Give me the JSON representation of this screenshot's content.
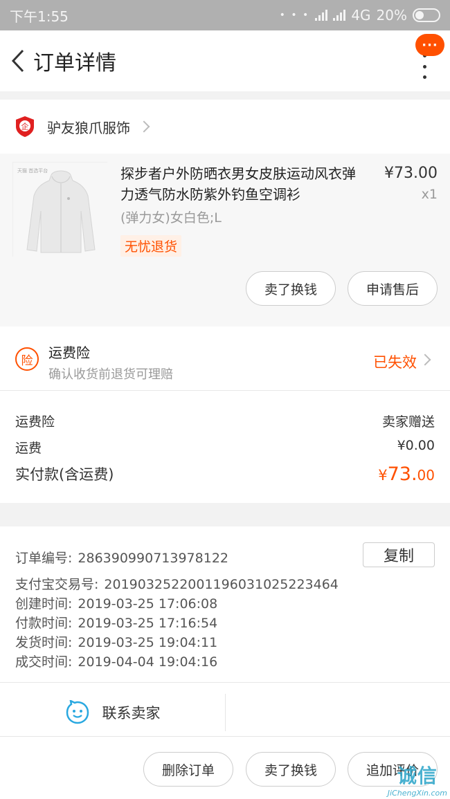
{
  "status_bar": {
    "time": "下午1:55",
    "network": "4G",
    "battery": "20%"
  },
  "header": {
    "title": "订单详情",
    "message_badge": "···"
  },
  "shop": {
    "badge_text": "企",
    "name": "驴友狼爪服饰"
  },
  "product": {
    "image_caption": "天猫 首选平台",
    "title": "探步者户外防晒衣男女皮肤运动风衣弹力透气防水防紫外钓鱼空调衫",
    "sku": "(弹力女)女白色;L",
    "tag": "无忧退货",
    "price": "¥73.00",
    "quantity": "x1",
    "buttons": {
      "sell": "卖了换钱",
      "after_sale": "申请售后"
    }
  },
  "insurance": {
    "icon_text": "险",
    "title": "运费险",
    "subtitle": "确认收货前退货可理赔",
    "status": "已失效"
  },
  "fees": {
    "rows": [
      {
        "label": "运费险",
        "value": "卖家赠送"
      },
      {
        "label": "运费",
        "value": "¥0.00"
      }
    ],
    "total_label": "实付款(含运费)",
    "total_currency": "¥",
    "total_int": "73.",
    "total_dec": "00"
  },
  "order_info": {
    "copy_label": "复制",
    "rows": [
      {
        "label": "订单编号:",
        "value": "286390990713978122"
      },
      {
        "label": "支付宝交易号:",
        "value": "2019032522001196031025223464"
      },
      {
        "label": "创建时间:",
        "value": "2019-03-25 17:06:08"
      },
      {
        "label": "付款时间:",
        "value": "2019-03-25 17:16:54"
      },
      {
        "label": "发货时间:",
        "value": "2019-03-25 19:04:11"
      },
      {
        "label": "成交时间:",
        "value": "2019-04-04 19:04:16"
      }
    ]
  },
  "contact": {
    "label": "联系卖家"
  },
  "bottom_bar": {
    "delete": "删除订单",
    "sell": "卖了换钱",
    "review": "追加评价"
  },
  "watermark": {
    "logo": "诚信",
    "text": "JiChengXin.com"
  },
  "colors": {
    "accent": "#ff5000",
    "status_bar": "#b0b0b0",
    "contact_icon": "#29a8e0"
  }
}
